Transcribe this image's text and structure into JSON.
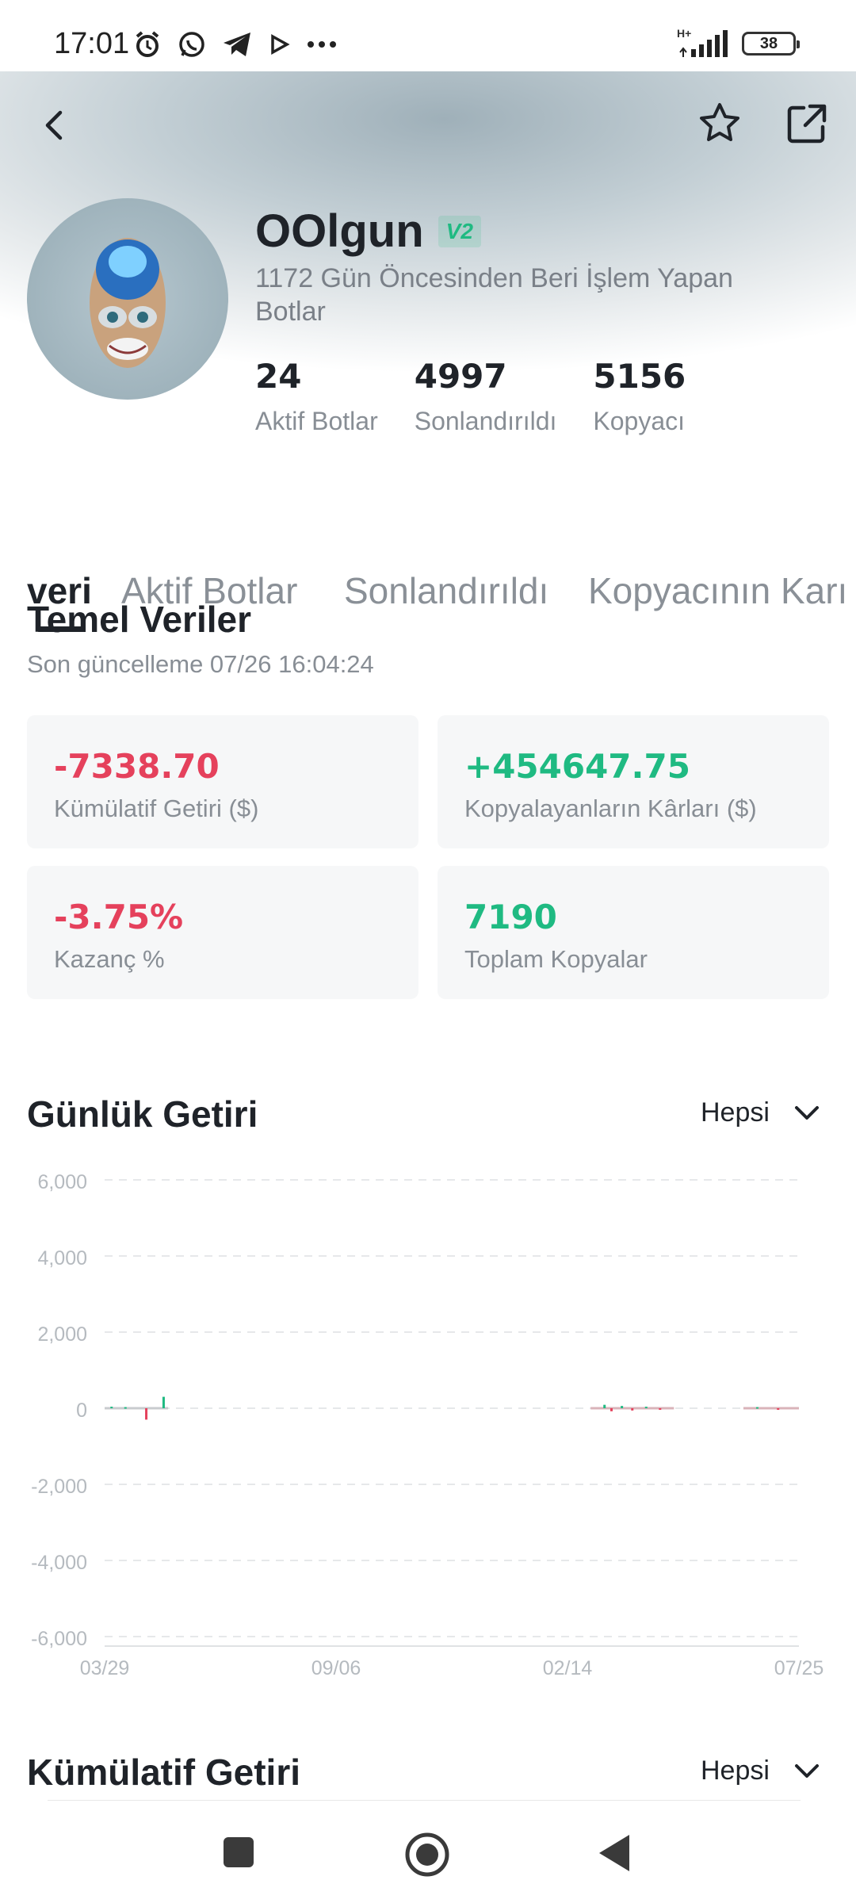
{
  "status_bar": {
    "time": "17:01",
    "network_label": "H+",
    "battery": "38",
    "icons": [
      "alarm-icon",
      "whatsapp-icon",
      "telegram-icon",
      "play-icon",
      "more-dots-icon",
      "signal-icon",
      "battery-icon"
    ]
  },
  "header": {
    "back_icon": "back-arrow-icon",
    "star_icon": "star-icon",
    "share_icon": "share-icon"
  },
  "profile": {
    "name": "OOlgun",
    "badge": "V2",
    "subtitle": "1172 Gün Öncesinden Beri İşlem Yapan Botlar",
    "stats": [
      {
        "value": "24",
        "label": "Aktif Botlar"
      },
      {
        "value": "4997",
        "label": "Sonlandırıldı"
      },
      {
        "value": "5156",
        "label": "Kopyacı"
      }
    ]
  },
  "tabs": [
    "veri",
    "Aktif Botlar",
    "Sonlandırıldı",
    "Kopyacının Karı"
  ],
  "basic_data": {
    "title": "Temel Veriler",
    "updated": "Son güncelleme 07/26 16:04:24",
    "cards": [
      {
        "value": "-7338.70",
        "label": "Kümülatif Getiri ($)",
        "tone": "neg"
      },
      {
        "value": "+454647.75",
        "label": "Kopyalayanların Kârları ($)",
        "tone": "pos"
      },
      {
        "value": "-3.75%",
        "label": "Kazanç %",
        "tone": "neg"
      },
      {
        "value": "7190",
        "label": "Toplam Kopyalar",
        "tone": "pos"
      }
    ]
  },
  "daily_return": {
    "title": "Günlük Getiri",
    "filter": "Hepsi"
  },
  "cumulative_return": {
    "title": "Kümülatif Getiri",
    "filter": "Hepsi"
  },
  "chart_data": {
    "type": "bar",
    "title": "Günlük Getiri",
    "x_ticks": [
      "03/29",
      "09/06",
      "02/14",
      "07/25"
    ],
    "y_ticks": [
      "6,000",
      "4,000",
      "2,000",
      "0",
      "-2,000",
      "-4,000",
      "-6,000"
    ],
    "ylim": [
      -6000,
      6000
    ],
    "grid": true,
    "series": [
      {
        "values": [
          {
            "x": 0.06,
            "y": -300
          },
          {
            "x": 0.085,
            "y": 300
          },
          {
            "x": 0.01,
            "y": 40
          },
          {
            "x": 0.03,
            "y": 30
          },
          {
            "x": 0.72,
            "y": 90
          },
          {
            "x": 0.73,
            "y": -80
          },
          {
            "x": 0.745,
            "y": 60
          },
          {
            "x": 0.76,
            "y": -60
          },
          {
            "x": 0.78,
            "y": 40
          },
          {
            "x": 0.8,
            "y": -40
          },
          {
            "x": 0.94,
            "y": 30
          },
          {
            "x": 0.97,
            "y": -30
          }
        ]
      }
    ],
    "colors": {
      "positive": "#1fba82",
      "negative": "#e5415c"
    }
  },
  "nav": {
    "icons": [
      "recent-apps-icon",
      "home-icon",
      "back-triangle-icon"
    ]
  }
}
